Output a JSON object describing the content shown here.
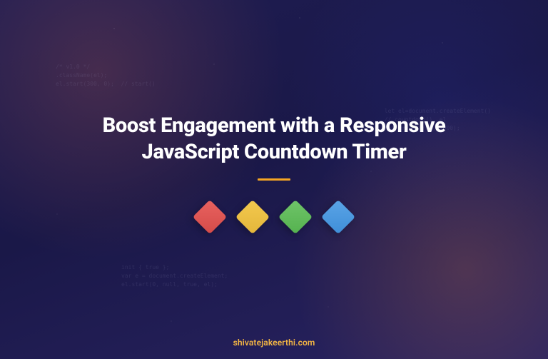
{
  "hero": {
    "title_line1": "Boost Engagement with a Responsive",
    "title_line2": "JavaScript Countdown Timer"
  },
  "footer": {
    "site": "shivatejakeerthi.com"
  },
  "decor": {
    "code_tl": "/* v1.0 */\n.className(el);\nel.start(300, 0);  // start()",
    "code_tr": "let el=document.createElement()\n// countdown(), el\nsetTimeout(run, 1000);",
    "code_bl": "init { true };\nvar e = document.createElement;\nel.start(0, null, true, el);"
  },
  "diamonds": {
    "colors": [
      "#e8625f",
      "#f3c94e",
      "#6fc469",
      "#5aa4e6"
    ]
  },
  "accent": "#f5a623"
}
